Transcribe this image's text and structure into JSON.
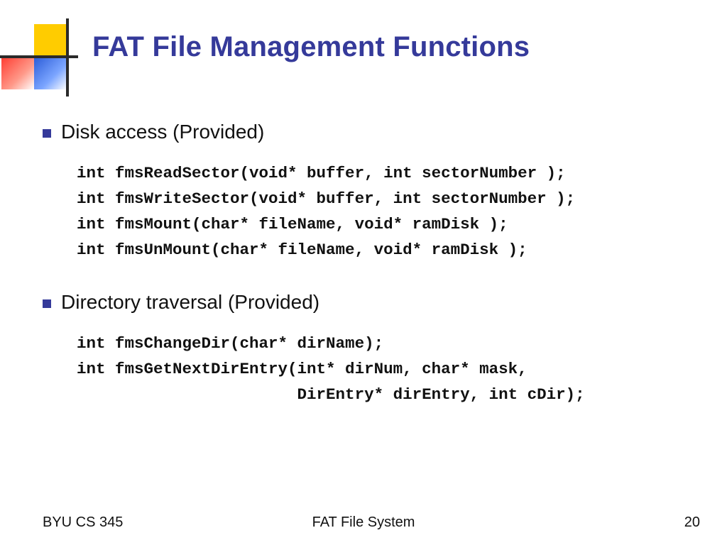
{
  "title": "FAT File Management Functions",
  "sections": [
    {
      "heading": "Disk access (Provided)",
      "code": [
        "int fmsReadSector(void* buffer, int sectorNumber );",
        "int fmsWriteSector(void* buffer, int sectorNumber );",
        "int fmsMount(char* fileName, void* ramDisk );",
        "int fmsUnMount(char* fileName, void* ramDisk );"
      ]
    },
    {
      "heading": "Directory traversal (Provided)",
      "code": [
        "int fmsChangeDir(char* dirName);",
        "int fmsGetNextDirEntry(int* dirNum, char* mask,",
        "                       DirEntry* dirEntry, int cDir);"
      ]
    }
  ],
  "footer": {
    "left": "BYU CS 345",
    "center": "FAT File System",
    "right": "20"
  }
}
